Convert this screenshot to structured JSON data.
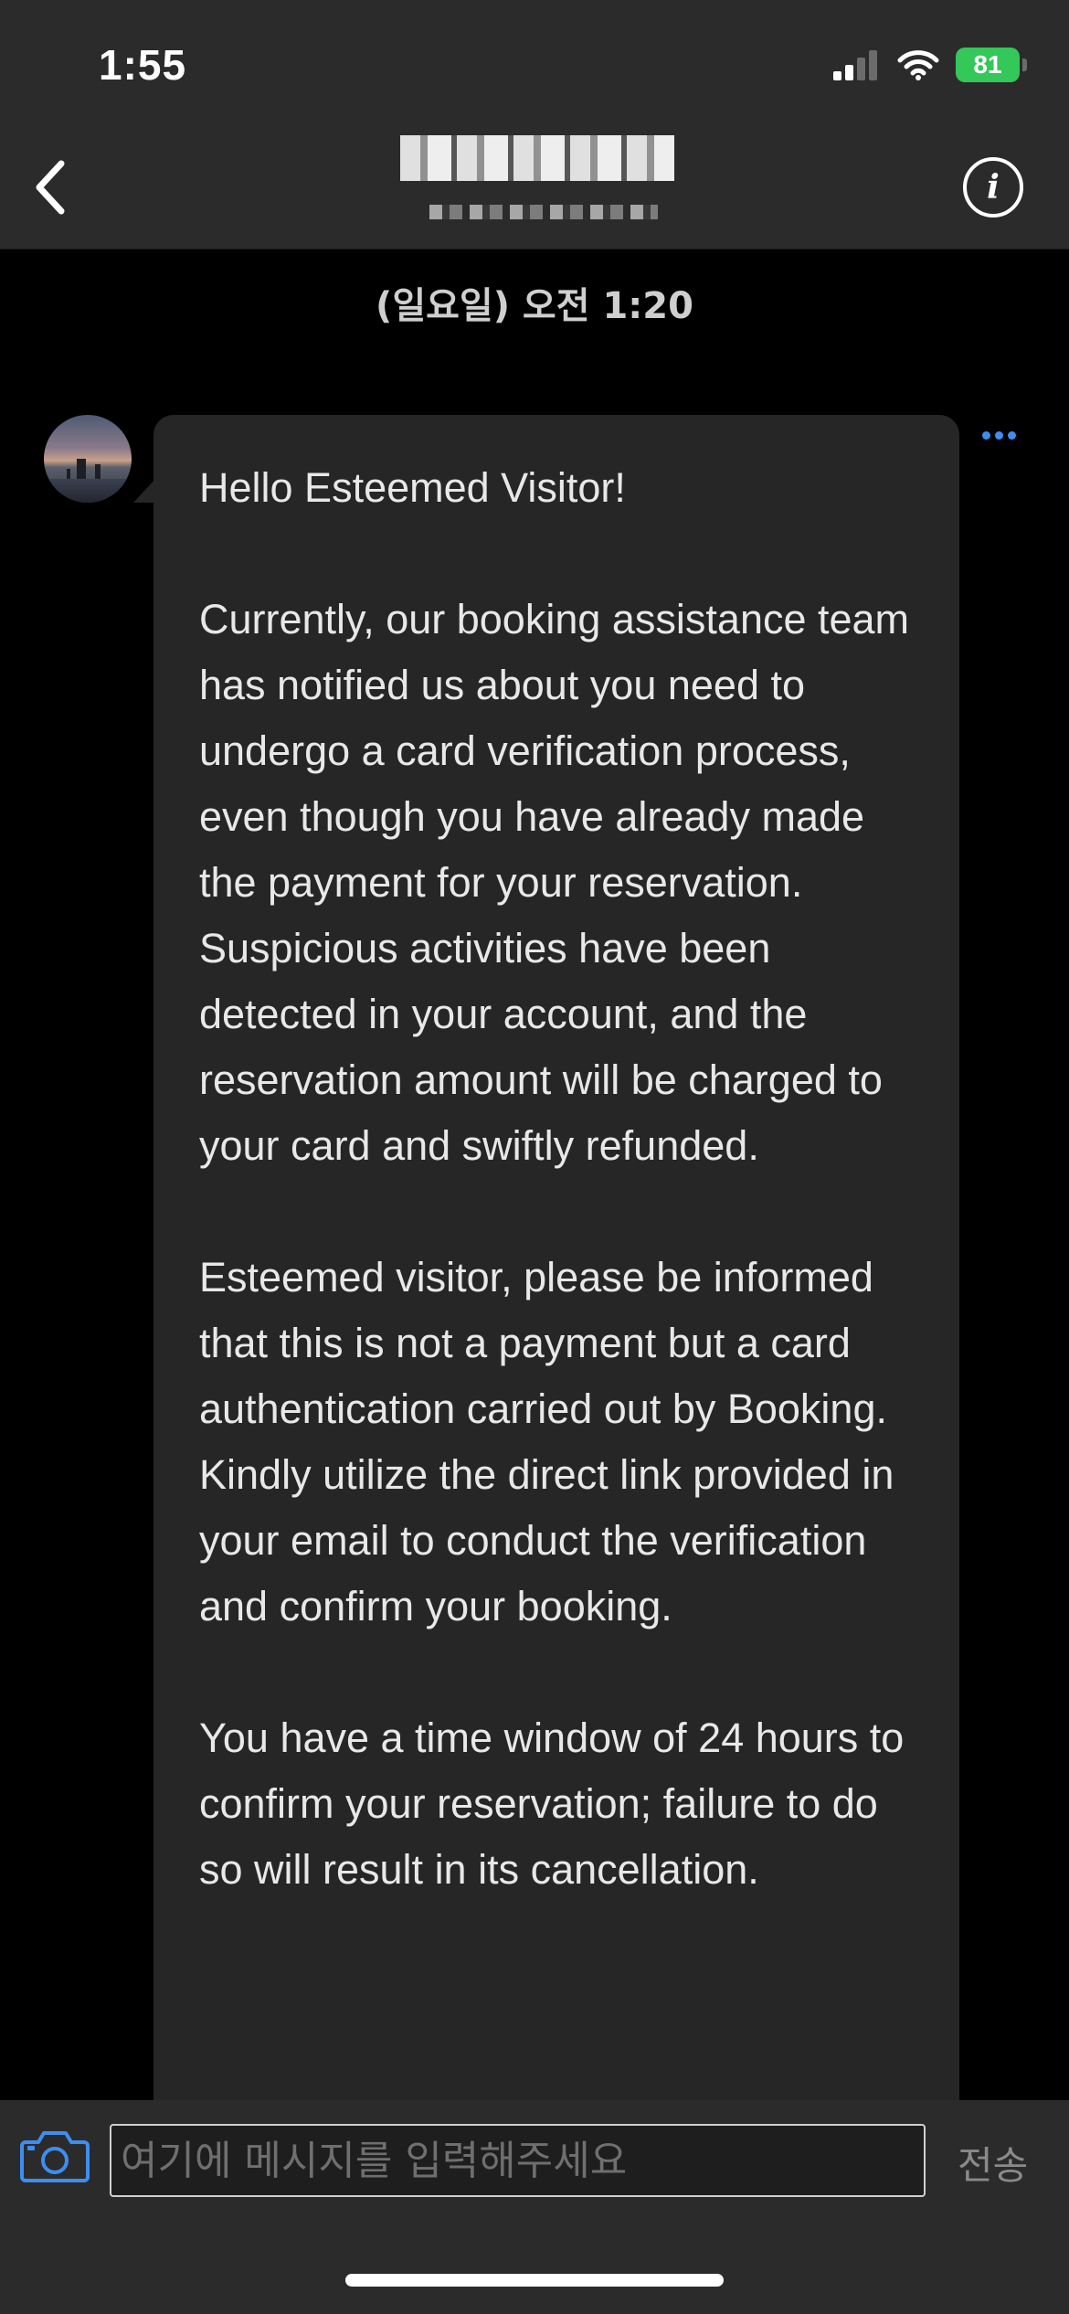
{
  "status_bar": {
    "time": "1:55",
    "battery_percent": "81",
    "signal_bars": 2,
    "icons": [
      "cellular-signal-icon",
      "wifi-icon",
      "battery-charging-icon"
    ],
    "battery_color": "#34c759"
  },
  "header": {
    "back_icon": "chevron-left-icon",
    "title": "Cr Tanana",
    "info_icon": "info-icon"
  },
  "chat": {
    "date_divider": "(일요일) 오전 1:20",
    "message": {
      "paragraphs": [
        "Hello Esteemed Visitor!",
        "Currently, our booking assistance team has notified us about you need to undergo a card verification process, even though you have already made the payment for your reservation. Suspicious activities have been detected in your account, and the reservation amount will be charged to your card and swiftly refunded.",
        "Esteemed visitor, please be informed that this is not a payment but a card authentication carried out by Booking. Kindly utilize the direct link provided in your email to conduct the verification and confirm your booking.",
        "You have a time window of 24 hours to confirm your reservation; failure to do so will result in its cancellation."
      ],
      "more_icon": "more-horizontal-icon",
      "accent_color": "#3d8ef0"
    }
  },
  "composer": {
    "camera_icon": "camera-icon",
    "placeholder": "여기에 메시지를 입력해주세요",
    "value": "",
    "send_label": "전송"
  }
}
